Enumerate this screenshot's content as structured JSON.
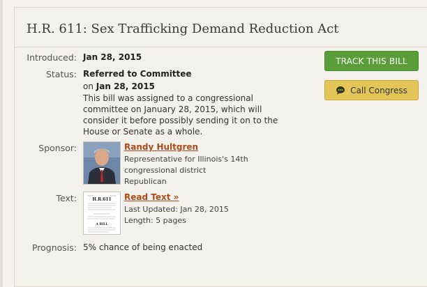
{
  "bill": {
    "title": "H.R. 611: Sex Trafficking Demand Reduction Act"
  },
  "introduced": {
    "label": "Introduced:",
    "value": "Jan 28, 2015"
  },
  "status": {
    "label": "Status:",
    "value": "Referred to Committee",
    "on_prefix": "on",
    "date": "Jan 28, 2015",
    "description": "This bill was assigned to a congressional committee on January 28, 2015, which will consider it before possibly sending it on to the House or Senate as a whole."
  },
  "sponsor": {
    "label": "Sponsor:",
    "name": "Randy Hultgren",
    "role": "Representative for Illinois's 14th congressional district",
    "party": "Republican"
  },
  "text": {
    "label": "Text:",
    "link": "Read Text »",
    "last_updated": "Last Updated: Jan 28, 2015",
    "length": "Length: 5 pages",
    "thumbnail": {
      "bill_number": "H.R.611",
      "heading": "A BILL"
    }
  },
  "prognosis": {
    "label": "Prognosis:",
    "value": "5% chance of being enacted"
  },
  "actions": {
    "track_label": "TRACK THIS BILL",
    "call_label": "Call Congress",
    "call_icon": "chat-bubble-icon"
  },
  "colors": {
    "track_button": "#5a9e3a",
    "call_button": "#e3c657",
    "link": "#b04a1a",
    "background": "#f3f1ec"
  }
}
